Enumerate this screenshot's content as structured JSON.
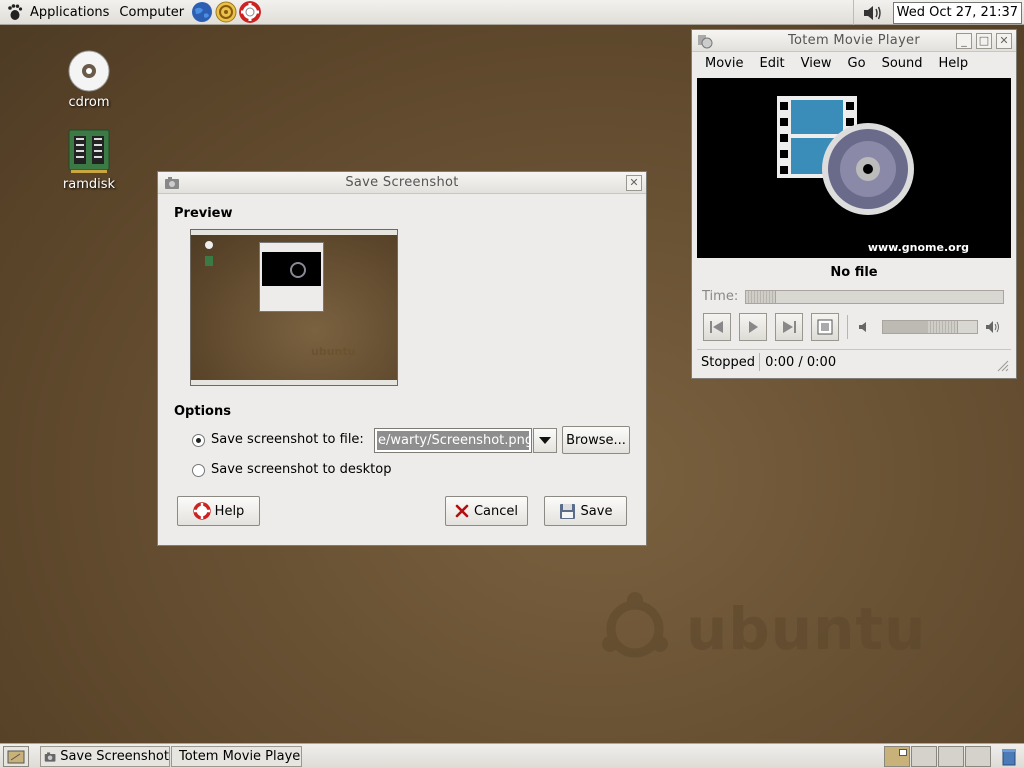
{
  "top_panel": {
    "applications": "Applications",
    "computer": "Computer",
    "clock": "Wed Oct 27, 21:37",
    "launchers": [
      "browser-globe-icon",
      "evolution-mail-icon",
      "help-lifebuoy-icon"
    ]
  },
  "desktop": {
    "icons": [
      {
        "label": "cdrom",
        "icon": "cdrom-icon"
      },
      {
        "label": "ramdisk",
        "icon": "ramdisk-chip-icon"
      }
    ],
    "watermark": "ubuntu"
  },
  "dialog": {
    "title": "Save Screenshot",
    "preview_heading": "Preview",
    "options_heading": "Options",
    "save_to_file_label": "Save screenshot to file:",
    "file_value": "e/warty/Screenshot.png",
    "browse_label": "Browse...",
    "save_to_desktop_label": "Save screenshot to desktop",
    "selected_option": "file",
    "help_label": "Help",
    "cancel_label": "Cancel",
    "save_label": "Save"
  },
  "totem": {
    "title": "Totem Movie Player",
    "menu": [
      "Movie",
      "Edit",
      "View",
      "Go",
      "Sound",
      "Help"
    ],
    "video_caption": "www.gnome.org",
    "file_label": "No file",
    "time_label": "Time:",
    "status": "Stopped",
    "time_readout": "0:00 / 0:00",
    "volume_level": 0.7
  },
  "taskbar": {
    "tasks": [
      "Save Screenshot",
      "Totem Movie Player"
    ],
    "active_workspace": 1
  },
  "colors": {
    "desktop_brown": "#6b5335",
    "panel": "#e8e6e1",
    "selection_gray": "#8e8e8e"
  }
}
